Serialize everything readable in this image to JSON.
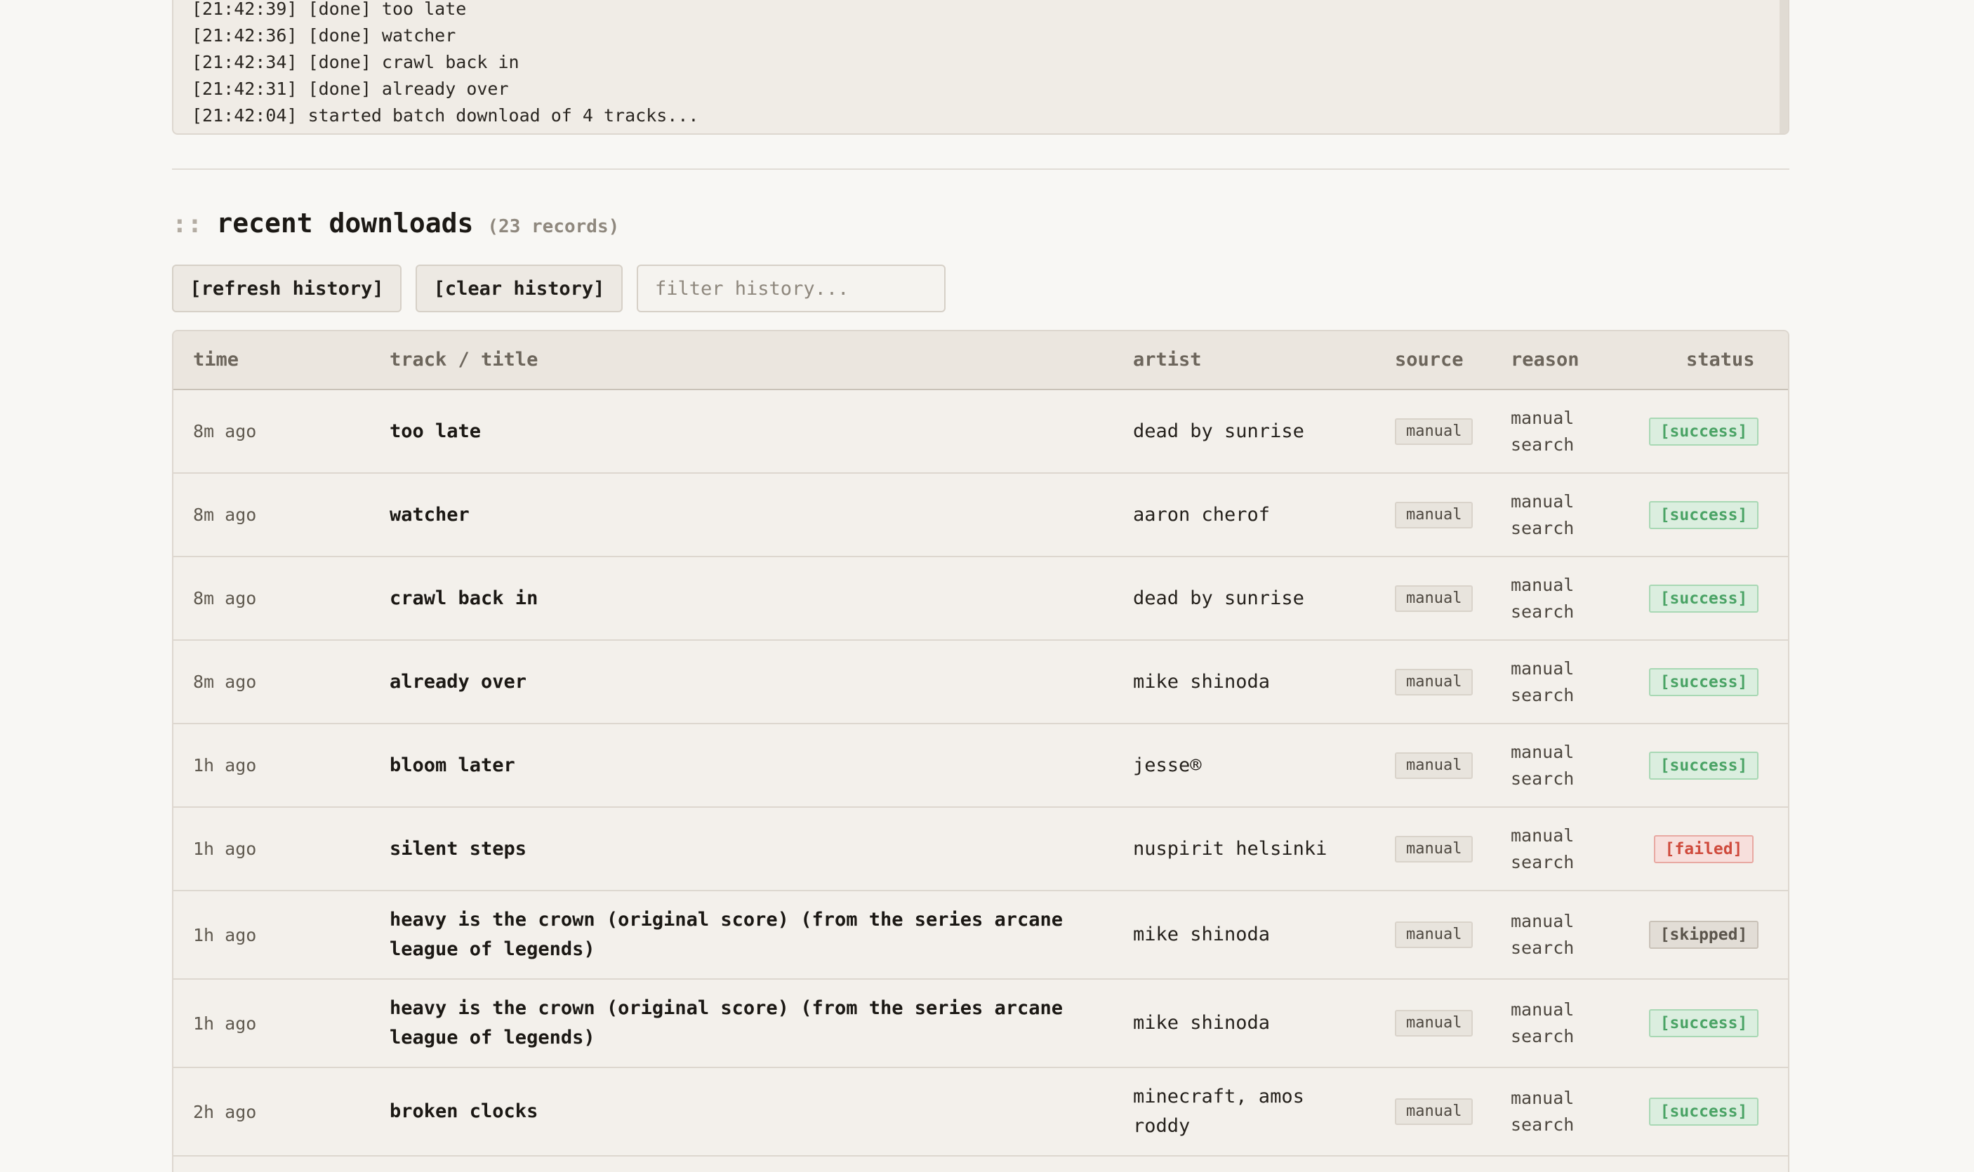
{
  "log": {
    "lines": [
      "[21:42:39] [done] too late",
      "[21:42:36] [done] watcher",
      "[21:42:34] [done] crawl back in",
      "[21:42:31] [done] already over",
      "[21:42:04] started batch download of 4 tracks..."
    ]
  },
  "history": {
    "prefix": "::",
    "title": "recent downloads",
    "count": "(23 records)",
    "refresh_label": "[refresh history]",
    "clear_label": "[clear history]",
    "filter_placeholder": "filter history...",
    "columns": {
      "time": "time",
      "title": "track / title",
      "artist": "artist",
      "source": "source",
      "reason": "reason",
      "status": "status"
    },
    "rows": [
      {
        "time": "8m ago",
        "title": "too late",
        "artist": "dead by sunrise",
        "source": "manual",
        "reason": "manual search",
        "status": "[success]",
        "status_kind": "success"
      },
      {
        "time": "8m ago",
        "title": "watcher",
        "artist": "aaron cherof",
        "source": "manual",
        "reason": "manual search",
        "status": "[success]",
        "status_kind": "success"
      },
      {
        "time": "8m ago",
        "title": "crawl back in",
        "artist": "dead by sunrise",
        "source": "manual",
        "reason": "manual search",
        "status": "[success]",
        "status_kind": "success"
      },
      {
        "time": "8m ago",
        "title": "already over",
        "artist": "mike shinoda",
        "source": "manual",
        "reason": "manual search",
        "status": "[success]",
        "status_kind": "success"
      },
      {
        "time": "1h ago",
        "title": "bloom later",
        "artist": "jesse®",
        "source": "manual",
        "reason": "manual search",
        "status": "[success]",
        "status_kind": "success"
      },
      {
        "time": "1h ago",
        "title": "silent steps",
        "artist": "nuspirit helsinki",
        "source": "manual",
        "reason": "manual search",
        "status": "[failed]",
        "status_kind": "failed"
      },
      {
        "time": "1h ago",
        "title": "heavy is the crown (original score) (from the series arcane league of legends)",
        "artist": "mike shinoda",
        "source": "manual",
        "reason": "manual search",
        "status": "[skipped]",
        "status_kind": "skipped"
      },
      {
        "time": "1h ago",
        "title": "heavy is the crown (original score) (from the series arcane league of legends)",
        "artist": "mike shinoda",
        "source": "manual",
        "reason": "manual search",
        "status": "[success]",
        "status_kind": "success"
      },
      {
        "time": "2h ago",
        "title": "broken clocks",
        "artist": "minecraft, amos roddy",
        "source": "manual",
        "reason": "manual search",
        "status": "[success]",
        "status_kind": "success"
      }
    ]
  },
  "colors": {
    "success": "#4aa365",
    "failed": "#cf4a3c",
    "skipped": "#5b554c",
    "background": "#f8f7f4"
  }
}
